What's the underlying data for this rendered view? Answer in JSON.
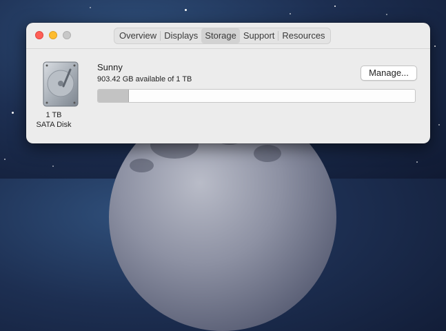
{
  "window": {
    "traffic_lights": [
      "close",
      "minimize",
      "zoom"
    ],
    "tabs": [
      {
        "label": "Overview",
        "active": false
      },
      {
        "label": "Displays",
        "active": false
      },
      {
        "label": "Storage",
        "active": true
      },
      {
        "label": "Support",
        "active": false
      },
      {
        "label": "Resources",
        "active": false
      }
    ]
  },
  "storage": {
    "disk_icon": "hard-disk-icon",
    "disk_capacity_label": "1 TB",
    "disk_type_label": "SATA Disk",
    "volume_name": "Sunny",
    "availability": "903.42 GB available of 1 TB",
    "manage_label": "Manage...",
    "used_fraction": 0.097
  },
  "colors": {
    "close": "#fe5f57",
    "minimize": "#febc2e",
    "zoom_disabled": "#c8c8c8",
    "used_bar": "#c3c3c3"
  }
}
